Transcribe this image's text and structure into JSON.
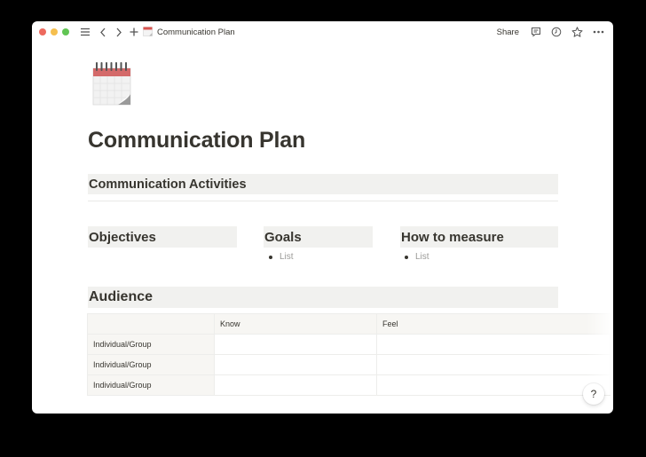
{
  "window": {
    "title": "Communication Plan",
    "page_icon": "spiral-calendar-icon"
  },
  "titlebar": {
    "icons": [
      "sidebar-menu-icon",
      "back-icon",
      "forward-icon",
      "new-page-icon"
    ],
    "share_label": "Share",
    "right_icons": [
      "comments-icon",
      "updates-clock-icon",
      "favorite-star-icon",
      "more-icon"
    ]
  },
  "page": {
    "title": "Communication Plan",
    "sections": {
      "activities": "Communication Activities",
      "objectives": "Objectives",
      "goals": {
        "heading": "Goals",
        "items": [
          "List"
        ]
      },
      "measure": {
        "heading": "How to measure",
        "items": [
          "List"
        ]
      },
      "audience": "Audience"
    }
  },
  "audience_table": {
    "columns": [
      "",
      "Know",
      "Feel"
    ],
    "rows": [
      [
        "Individual/Group",
        "",
        ""
      ],
      [
        "Individual/Group",
        "",
        ""
      ],
      [
        "Individual/Group",
        "",
        ""
      ]
    ]
  },
  "help": {
    "label": "?"
  },
  "colors": {
    "heading_bg": "#f1f1ef",
    "text": "#37352f",
    "muted": "#9b9a97",
    "table_head_bg": "#f7f6f3",
    "traffic_red": "#ed6a5e",
    "traffic_yellow": "#f5bf4f",
    "traffic_green": "#61c554"
  }
}
